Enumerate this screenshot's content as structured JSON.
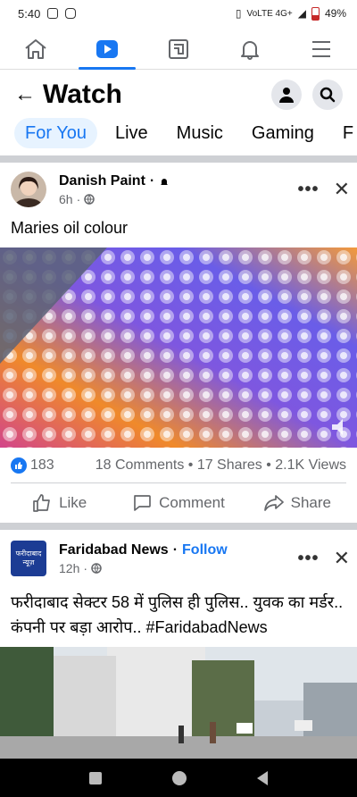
{
  "status_bar": {
    "time": "5:40",
    "network": "VoLTE 4G+",
    "battery": "49%"
  },
  "top_nav": {
    "tabs": [
      {
        "name": "home-icon",
        "active": false
      },
      {
        "name": "watch-icon",
        "active": true
      },
      {
        "name": "marketplace-icon",
        "active": false
      },
      {
        "name": "notifications-icon",
        "active": false
      },
      {
        "name": "menu-icon",
        "active": false
      }
    ]
  },
  "header": {
    "title": "Watch"
  },
  "chips": {
    "for_you": "For You",
    "live": "Live",
    "music": "Music",
    "gaming": "Gaming",
    "more": "F"
  },
  "post1": {
    "author": "Danish Paint",
    "separator": "·",
    "time": "6h",
    "caption": "Maries oil colour",
    "reactions": "183",
    "comments": "18 Comments",
    "shares": "17 Shares",
    "views": "2.1K Views"
  },
  "actions": {
    "like": "Like",
    "comment": "Comment",
    "share": "Share"
  },
  "post2": {
    "author": "Faridabad News",
    "separator": "·",
    "follow": "Follow",
    "time": "12h",
    "logo_text": "फरीदाबाद न्यूज़",
    "caption": "फरीदाबाद सेक्टर 58 में पुलिस ही पुलिस.. युवक का मर्डर.. कंपनी पर बड़ा आरोप.. #FaridabadNews"
  },
  "colors": {
    "accent": "#1877f2",
    "chip_active_bg": "#e7f3ff",
    "divider": "#ced0d4"
  }
}
